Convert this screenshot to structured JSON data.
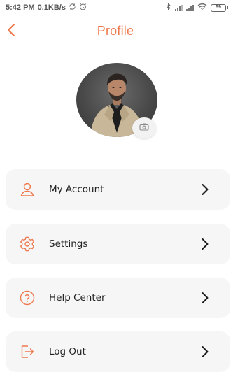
{
  "status_bar": {
    "time": "5:42 PM",
    "speed": "0.1KB/s",
    "battery": "59",
    "icons": [
      "sync-icon",
      "alarm-icon",
      "bluetooth-icon",
      "signal-icon",
      "signal-icon",
      "wifi-icon",
      "battery-icon"
    ]
  },
  "header": {
    "title": "Profile",
    "back_icon": "chevron-left-icon"
  },
  "profile": {
    "camera_icon": "camera-icon"
  },
  "menu": {
    "items": [
      {
        "label": "My Account",
        "icon": "person-icon"
      },
      {
        "label": "Settings",
        "icon": "gear-icon"
      },
      {
        "label": "Help Center",
        "icon": "question-circle-icon"
      },
      {
        "label": "Log Out",
        "icon": "logout-icon"
      }
    ]
  },
  "colors": {
    "accent": "#ee7a4f",
    "card_background": "#f6f6f6",
    "text": "#222222"
  }
}
